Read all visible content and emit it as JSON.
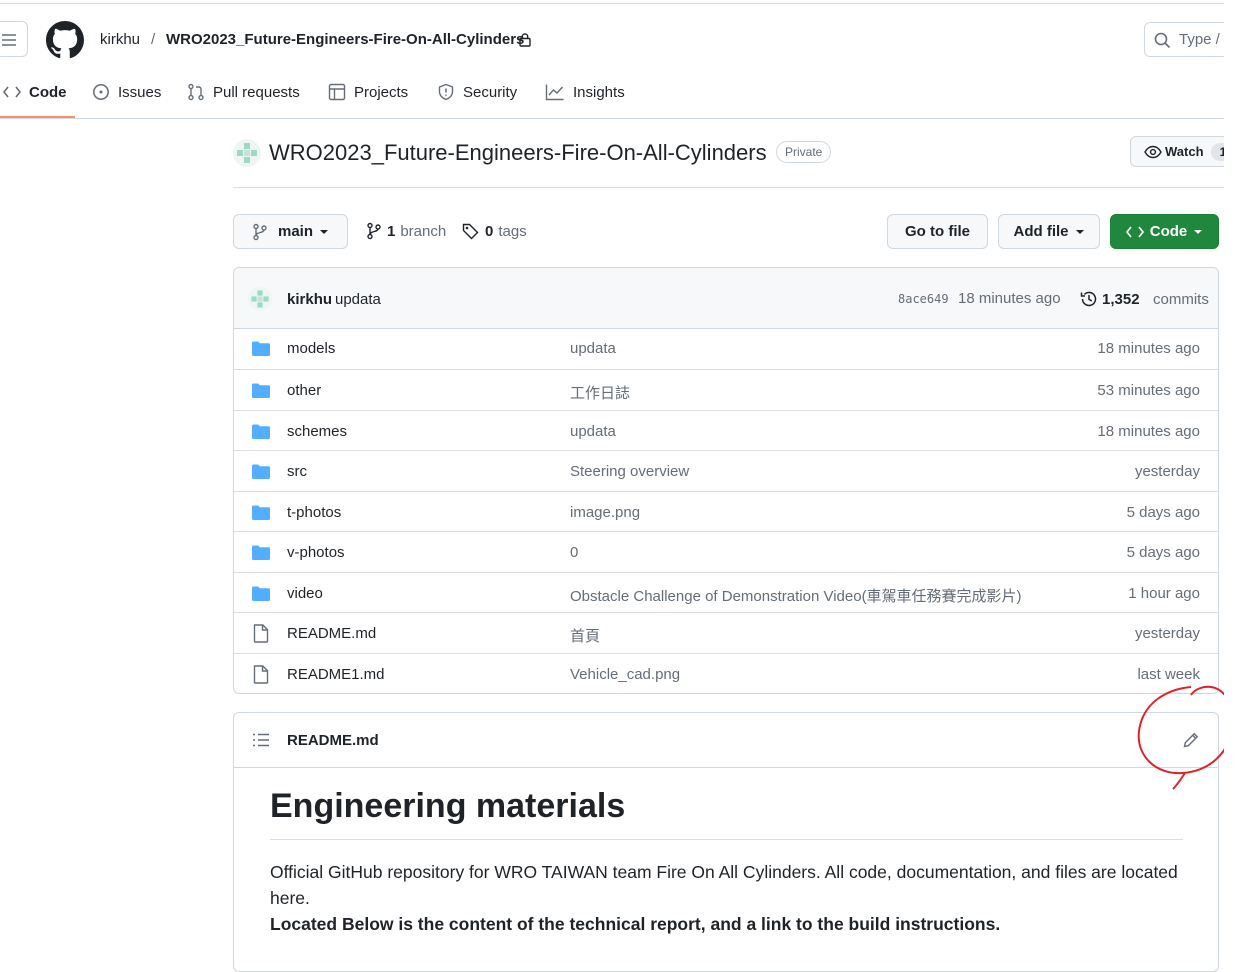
{
  "header": {
    "owner": "kirkhu",
    "separator": "/",
    "repo": "WRO2023_Future-Engineers-Fire-On-All-Cylinders",
    "search_placeholder": "Type /"
  },
  "tabs": [
    {
      "label": "Code",
      "icon": "code-icon",
      "active": true
    },
    {
      "label": "Issues",
      "icon": "issue-icon"
    },
    {
      "label": "Pull requests",
      "icon": "pull-request-icon"
    },
    {
      "label": "Projects",
      "icon": "table-icon"
    },
    {
      "label": "Security",
      "icon": "shield-icon"
    },
    {
      "label": "Insights",
      "icon": "graph-icon"
    }
  ],
  "repo": {
    "title": "WRO2023_Future-Engineers-Fire-On-All-Cylinders",
    "visibility": "Private",
    "watch_label": "Watch",
    "watch_count": "1"
  },
  "toolbar": {
    "branch": "main",
    "branch_count": "1",
    "branch_label": "branch",
    "tag_count": "0",
    "tag_label": "tags",
    "go_to_file": "Go to file",
    "add_file": "Add file",
    "code": "Code"
  },
  "commit": {
    "author": "kirkhu",
    "message": "updata",
    "sha": "8ace649",
    "time": "18 minutes ago",
    "count": "1,352",
    "count_label": "commits"
  },
  "files": [
    {
      "name": "models",
      "type": "folder",
      "message": "updata",
      "age": "18 minutes ago"
    },
    {
      "name": "other",
      "type": "folder",
      "message": "工作日誌",
      "age": "53 minutes ago"
    },
    {
      "name": "schemes",
      "type": "folder",
      "message": "updata",
      "age": "18 minutes ago"
    },
    {
      "name": "src",
      "type": "folder",
      "message": "Steering overview",
      "age": "yesterday"
    },
    {
      "name": "t-photos",
      "type": "folder",
      "message": "image.png",
      "age": "5 days ago"
    },
    {
      "name": "v-photos",
      "type": "folder",
      "message": "0",
      "age": "5 days ago"
    },
    {
      "name": "video",
      "type": "folder",
      "message": "Obstacle Challenge of Demonstration Video(車駕車任務賽完成影片)",
      "age": "1 hour ago"
    },
    {
      "name": "README.md",
      "type": "file",
      "message": "首頁",
      "age": "yesterday"
    },
    {
      "name": "README1.md",
      "type": "file",
      "message": "Vehicle_cad.png",
      "age": "last week"
    }
  ],
  "readme": {
    "filename": "README.md",
    "heading": "Engineering materials",
    "paragraph": "Official GitHub repository for WRO TAIWAN team Fire On All Cylinders. All code, documentation, and files are located here.",
    "bold_line": "Located Below is the content of the technical report, and a link to the build instructions."
  },
  "colors": {
    "accent_green": "#1f883d",
    "folder_blue": "#54aeff",
    "tab_underline": "#fd8c73",
    "annotation_red": "#e0202a"
  }
}
